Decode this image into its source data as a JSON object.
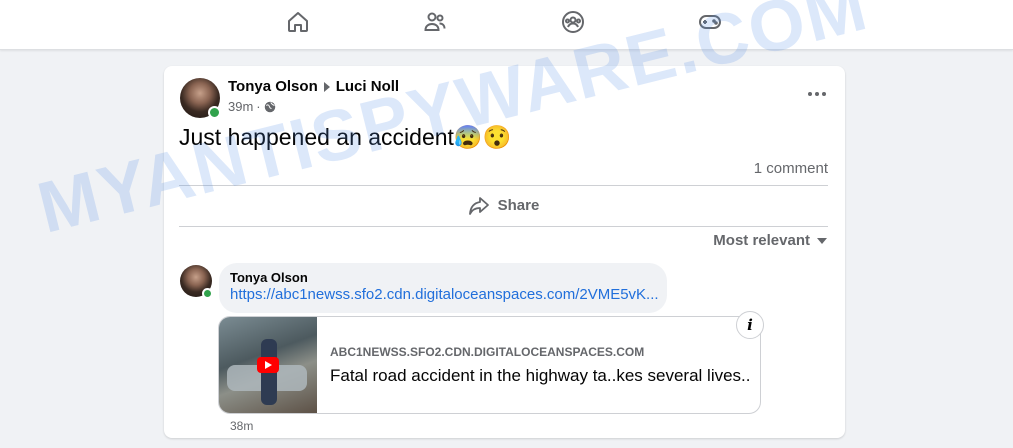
{
  "nav": {
    "items": [
      {
        "icon": "home-icon"
      },
      {
        "icon": "friends-icon"
      },
      {
        "icon": "groups-icon"
      },
      {
        "icon": "gaming-icon"
      }
    ]
  },
  "post": {
    "author": "Tonya Olson",
    "recipient": "Luci Noll",
    "time": "39m",
    "privacy_icon": "globe-icon",
    "text": "Just happened an accident😰😯",
    "comment_count": "1 comment",
    "share_label": "Share",
    "sort_label": "Most relevant"
  },
  "comment": {
    "author": "Tonya Olson",
    "link_text": "https://abc1newss.sfo2.cdn.digitaloceanspaces.com/2VME5vK...",
    "time": "38m",
    "preview": {
      "domain": "ABC1NEWSS.SFO2.CDN.DIGITALOCEANSPACES.COM",
      "title": "Fatal road accident in the highway ta..kes several lives.."
    }
  },
  "watermark": "MYANTISPYWARE.COM",
  "colors": {
    "link": "#216fdb",
    "secondary_text": "#65676b",
    "online": "#31a24c",
    "page_bg": "#f0f2f5"
  }
}
